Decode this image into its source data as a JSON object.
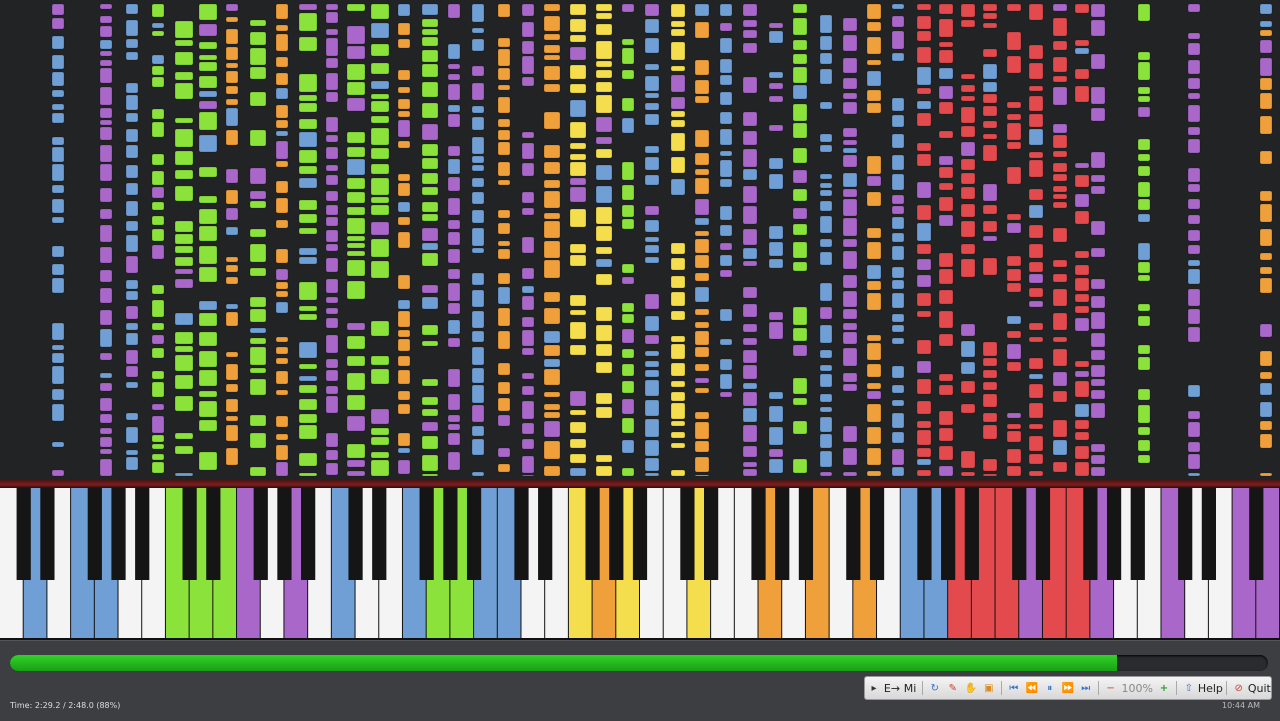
{
  "status": {
    "time_readout": "Time:  2:29.2 / 2:48.0 (88%)",
    "progress_fraction": 0.88,
    "clock": "10:44 AM"
  },
  "toolbar": {
    "mi_label": "Mi",
    "zoom_label": "100%",
    "help_label": "Help",
    "quit_label": "Quit"
  },
  "colors": {
    "background": "#222324",
    "blue": "#6f9fd4",
    "green": "#8ae23a",
    "purple": "#a968c9",
    "orange": "#f0a03a",
    "yellow": "#f4de4e",
    "red": "#e24a4e",
    "progress": "#22c01c"
  },
  "keyboard": {
    "key_colors": [
      "white",
      "blue",
      "white",
      "blue",
      "blue",
      "white",
      "white",
      "green",
      "green",
      "green",
      "purple",
      "white",
      "purple",
      "white",
      "blue",
      "white",
      "white",
      "blue",
      "green",
      "green",
      "blue",
      "blue",
      "white",
      "white",
      "yellow",
      "orange",
      "yellow",
      "white",
      "white",
      "yellow",
      "white",
      "white",
      "orange",
      "white",
      "orange",
      "white",
      "orange",
      "white",
      "blue",
      "blue",
      "red",
      "red",
      "red",
      "purple",
      "red",
      "red",
      "purple",
      "white",
      "white",
      "purple",
      "white",
      "white",
      "purple",
      "purple"
    ]
  }
}
